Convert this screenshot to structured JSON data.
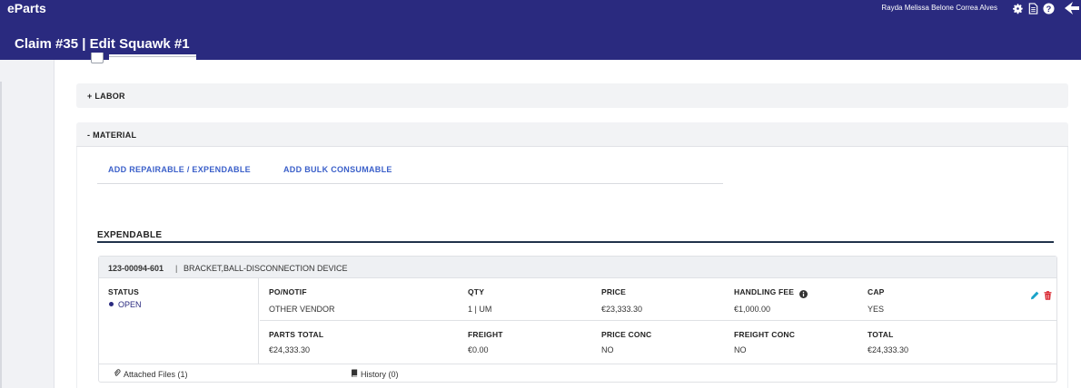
{
  "app": {
    "brand": "eParts",
    "user_name": "Rayda Melissa Belone Correa Alves"
  },
  "page": {
    "title": "Claim #35 | Edit Squawk #1"
  },
  "sections": {
    "labor_label": "+ LABOR",
    "material_label": "- MATERIAL"
  },
  "material": {
    "add_repairable_label": "ADD REPAIRABLE / EXPENDABLE",
    "add_bulk_label": "ADD BULK CONSUMABLE",
    "expendable_title": "EXPENDABLE"
  },
  "part": {
    "part_number": "123-00094-601",
    "separator": "|",
    "description": "BRACKET,BALL-DISCONNECTION DEVICE",
    "status_label": "STATUS",
    "status_value": "OPEN",
    "po_label": "PO/NOTIF",
    "po_value": "OTHER VENDOR",
    "qty_label": "QTY",
    "qty_value": "1 | UM",
    "price_label": "PRICE",
    "price_value": "€23,333.30",
    "handling_fee_label": "HANDLING FEE",
    "handling_fee_value": "€1,000.00",
    "cap_label": "CAP",
    "cap_value": "YES",
    "parts_total_label": "PARTS TOTAL",
    "parts_total_value": "€24,333.30",
    "freight_label": "FREIGHT",
    "freight_value": "€0.00",
    "price_conc_label": "PRICE CONC",
    "price_conc_value": "NO",
    "freight_conc_label": "FREIGHT CONC",
    "freight_conc_value": "NO",
    "total_label": "TOTAL",
    "total_value": "€24,333.30",
    "attached_files_label": "Attached Files (1)",
    "history_label": "History (0)"
  },
  "colors": {
    "header_bg": "#2a2a7f",
    "link": "#3a5fc9",
    "edit_icon": "#1aa3c9",
    "delete_icon": "#d9232d"
  },
  "icons": [
    "gear-icon",
    "document-icon",
    "help-icon",
    "collapse-sidebar-icon",
    "info-icon",
    "pencil-icon",
    "trash-icon",
    "paperclip-icon",
    "book-icon"
  ]
}
